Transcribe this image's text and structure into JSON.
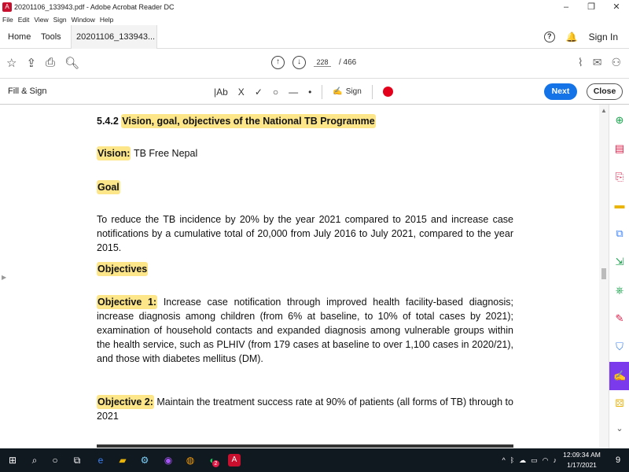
{
  "window": {
    "title": "20201106_133943.pdf - Adobe Acrobat Reader DC",
    "controls": {
      "minimize": "–",
      "maximize": "❐",
      "close": "✕"
    }
  },
  "menu": [
    "File",
    "Edit",
    "View",
    "Sign",
    "Window",
    "Help"
  ],
  "tabs": {
    "home": "Home",
    "tools": "Tools",
    "doc": "20201106_133943...",
    "doc_close": "×"
  },
  "header_right": {
    "help": "?",
    "signin": "Sign In"
  },
  "toolbar": {
    "page_current": "228",
    "page_total": "/ 466"
  },
  "fill_sign": {
    "title": "Fill & Sign",
    "text_tool": "|Ab",
    "cross": "X",
    "check": "✓",
    "circle": "○",
    "line": "—",
    "dot": "•",
    "sign_label": "Sign",
    "next_label": "Next",
    "close_label": "Close"
  },
  "document": {
    "section_num": "5.4.2",
    "section_title": "Vision, goal, objectives of the National TB Programme",
    "vision_label": "Vision:",
    "vision_text": "TB Free Nepal",
    "goal_label": "Goal",
    "goal_text": "To reduce the TB incidence by 20% by the year 2021 compared to 2015 and increase case notifications by a cumulative total of 20,000 from July 2016 to July 2021, compared to the year 2015.",
    "objectives_label": "Objectives",
    "obj1_label": "Objective 1:",
    "obj1_text": "Increase case notification through improved health facility-based diagnosis; increase diagnosis among children (from 6% at baseline, to 10% of total cases by 2021); examination of household contacts and expanded diagnosis among vulnerable groups within the health service, such as PLHIV (from 179 cases at baseline to over 1,100 cases in 2020/21), and those with diabetes mellitus (DM).",
    "obj2_label": "Objective 2:",
    "obj2_text": "Maintain the treatment success rate at 90% of patients (all forms of TB) through to 2021"
  },
  "taskbar": {
    "clock_time": "12:09:34 AM",
    "clock_date": "1/17/2021",
    "notif_count": "9",
    "chrome_badge": "2"
  },
  "colors": {
    "highlight": "#fde68a",
    "accent_blue": "#1473e6",
    "accent_purple": "#7c3aed",
    "red": "#e3001b"
  }
}
